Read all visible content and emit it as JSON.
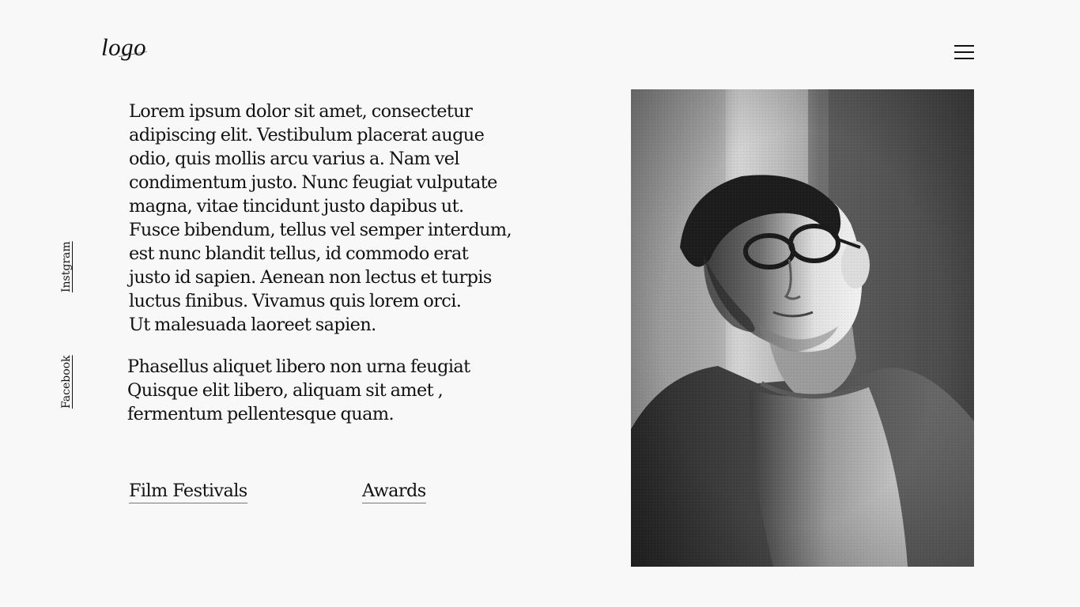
{
  "header": {
    "logo_text": "logo",
    "menu_icon": "hamburger-menu-icon"
  },
  "social": {
    "instagram_label": "Instgram",
    "facebook_label": "Facebook"
  },
  "intro": {
    "lines": [
      "Lorem ipsum dolor sit amet, consectetur",
      "adipiscing elit. Vestibulum placerat augue",
      "odio, quis mollis arcu varius a. Nam vel",
      "condimentum justo. Nunc feugiat vulputate",
      "magna, vitae tincidunt justo dapibus ut.",
      "Fusce bibendum, tellus vel semper interdum,",
      "est nunc blandit tellus, id commodo erat",
      "justo id sapien. Aenean non lectus et turpis",
      "luctus finibus. Vivamus quis lorem orci.",
      "Ut malesuada laoreet sapien."
    ]
  },
  "secondary": {
    "lines": [
      "Phasellus aliquet libero non urna feugiat",
      "Quisque elit libero, aliquam sit amet ,",
      "fermentum pellentesque quam."
    ]
  },
  "links": {
    "film_festivals": "Film Festivals",
    "awards": "Awards"
  },
  "portrait": {
    "description_icon": "portrait-photo",
    "style": "black-and-white"
  }
}
